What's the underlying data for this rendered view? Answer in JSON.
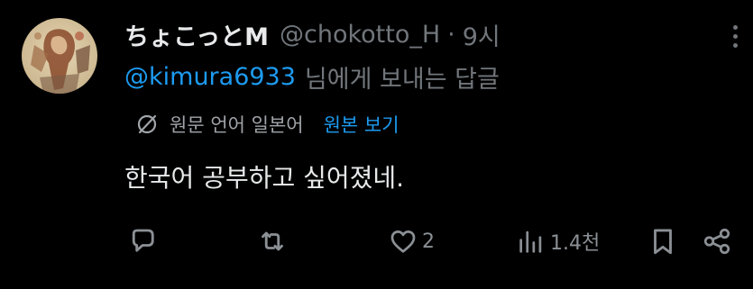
{
  "tweet": {
    "display_name": "ちょこっとM",
    "handle": "@chokotto_H",
    "separator": "·",
    "time": "9시",
    "reply_to_handle": "@kimura6933",
    "reply_to_suffix": "님에게 보내는 답글",
    "translation_info": "원문 언어 일본어",
    "show_original_label": "원본 보기",
    "text": "한국어 공부하고 싶어졌네."
  },
  "actions": {
    "reply_icon": "reply-icon",
    "retweet_icon": "retweet-icon",
    "like_icon": "heart-icon",
    "like_count": "2",
    "views_icon": "views-icon",
    "views_count": "1.4천",
    "bookmark_icon": "bookmark-icon",
    "share_icon": "share-icon"
  },
  "colors": {
    "background": "#000000",
    "text_primary": "#e7e9ea",
    "text_secondary": "#71767b",
    "link": "#1d9bf0"
  }
}
